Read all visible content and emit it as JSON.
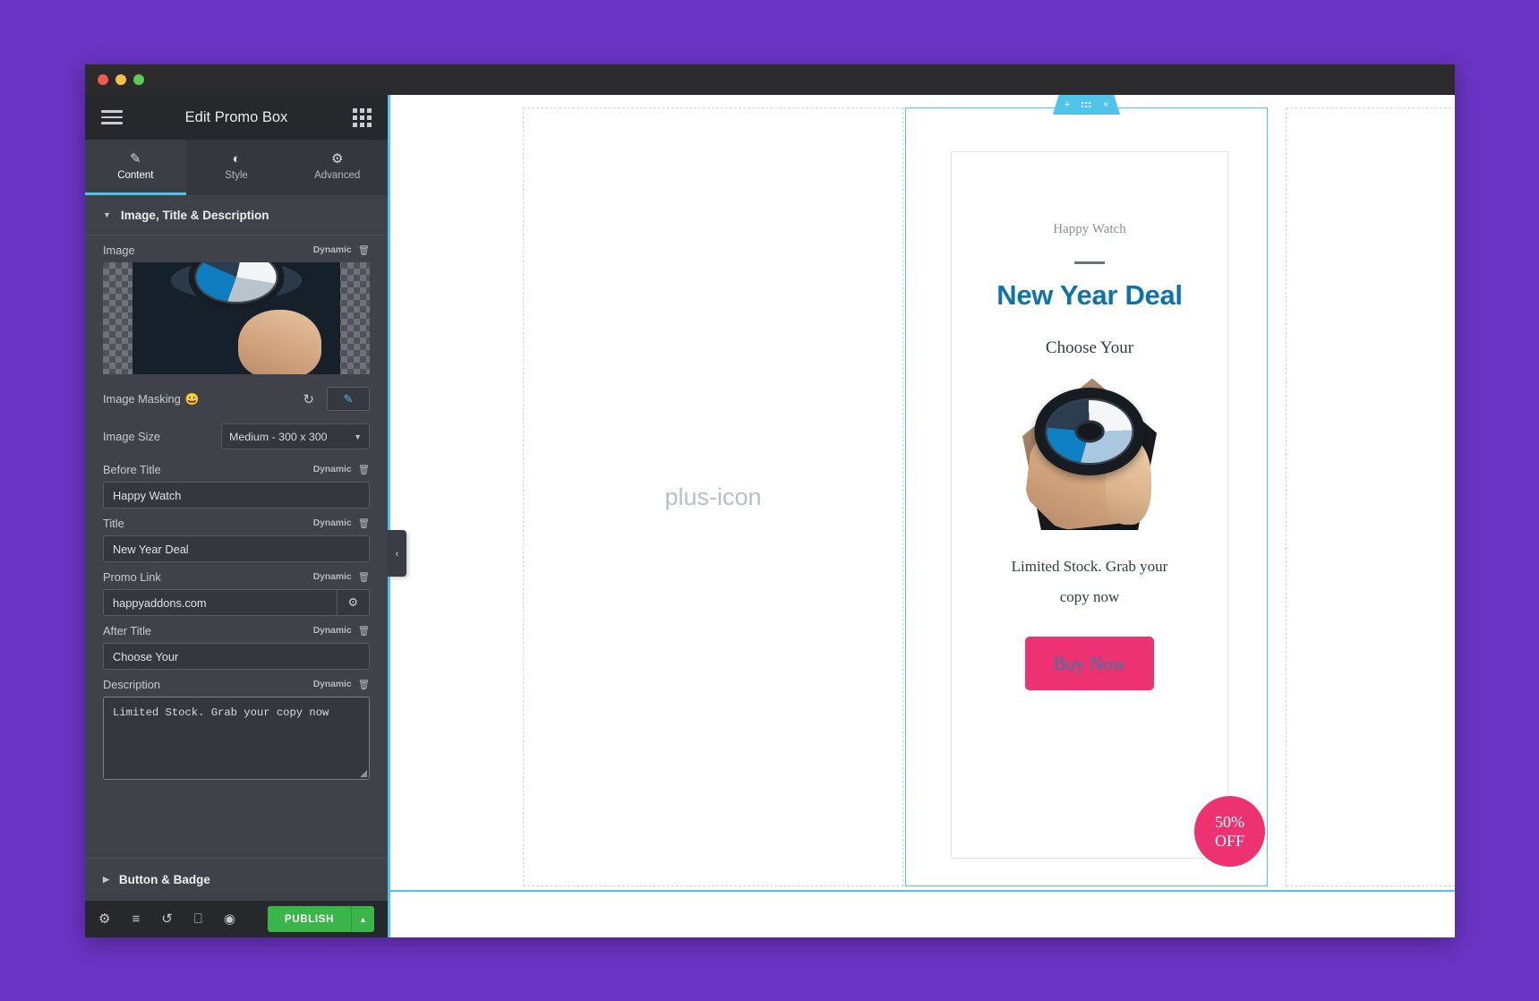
{
  "window": {
    "traffic_lights": [
      "close",
      "minimize",
      "maximize"
    ]
  },
  "panel": {
    "title": "Edit Promo Box",
    "menu_icon": "hamburger-icon",
    "apps_icon": "grid-apps-icon",
    "tabs": [
      {
        "label": "Content",
        "icon": "pencil-icon",
        "active": true
      },
      {
        "label": "Style",
        "icon": "contrast-icon",
        "active": false
      },
      {
        "label": "Advanced",
        "icon": "gear-icon",
        "active": false
      }
    ],
    "section": {
      "title": "Image, Title & Description",
      "expanded": true
    },
    "dynamic_label": "Dynamic",
    "fields": {
      "image": {
        "label": "Image",
        "dynamic": "Dynamic"
      },
      "image_masking": {
        "label": "Image Masking",
        "emoji": "😀",
        "reset_icon": "reset-icon",
        "edit_icon": "pencil-icon"
      },
      "image_size": {
        "label": "Image Size",
        "value": "Medium - 300 x 300"
      },
      "before_title": {
        "label": "Before Title",
        "dynamic": "Dynamic",
        "value": "Happy Watch"
      },
      "title": {
        "label": "Title",
        "dynamic": "Dynamic",
        "value": "New Year Deal"
      },
      "promo_link": {
        "label": "Promo Link",
        "dynamic": "Dynamic",
        "value": "happyaddons.com",
        "settings_icon": "gear-icon"
      },
      "after_title": {
        "label": "After Title",
        "dynamic": "Dynamic",
        "value": "Choose Your"
      },
      "description": {
        "label": "Description",
        "dynamic": "Dynamic",
        "value": "Limited Stock. Grab your copy now"
      }
    },
    "section_footer": {
      "title": "Button & Badge",
      "expanded": false
    },
    "footer": {
      "icons": [
        {
          "name": "settings-icon",
          "glyph": "⚙"
        },
        {
          "name": "layers-icon",
          "glyph": "≡"
        },
        {
          "name": "history-icon",
          "glyph": "↺"
        },
        {
          "name": "responsive-icon",
          "glyph": "⎕"
        },
        {
          "name": "preview-icon",
          "glyph": "◉"
        }
      ],
      "publish_label": "PUBLISH",
      "publish_arrow": "▲"
    },
    "collapse_handle": "‹"
  },
  "canvas": {
    "columns": [
      {
        "name": "empty-column-left",
        "add_icon": "plus-icon"
      },
      {
        "name": "promo-box-column",
        "selected": true
      },
      {
        "name": "empty-column-right"
      }
    ],
    "widget_toolbar": {
      "add": "+",
      "handle": "drag-handle",
      "close": "×"
    },
    "promo_box": {
      "before_title": "Happy Watch",
      "title": "New Year Deal",
      "after_title": "Choose Your",
      "description": "Limited Stock. Grab your copy now",
      "button_label": "Buy Now",
      "badge_line1": "50%",
      "badge_line2": "OFF"
    }
  },
  "colors": {
    "accent_blue": "#4fc3e8",
    "title_blue": "#0e74a8",
    "pink": "#ed3272",
    "publish_green": "#39b54a",
    "desktop_purple": "#6B34C4"
  }
}
